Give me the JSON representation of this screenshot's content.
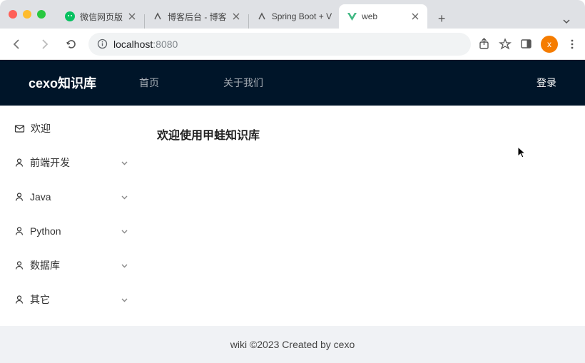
{
  "browser": {
    "tabs": [
      {
        "title": "微信网页版",
        "favicon": "wechat"
      },
      {
        "title": "博客后台 - 博客",
        "favicon": "generic"
      },
      {
        "title": "Spring Boot + V",
        "favicon": "generic"
      },
      {
        "title": "web",
        "favicon": "vue"
      }
    ],
    "active_tab_index": 3,
    "url_host": "localhost",
    "url_port": ":8080",
    "avatar_letter": "x"
  },
  "app": {
    "brand": "cexo知识库",
    "menu": [
      {
        "label": "首页"
      },
      {
        "label": "关于我们"
      }
    ],
    "login_label": "登录",
    "sidebar": [
      {
        "icon": "mail",
        "label": "欢迎",
        "expandable": false
      },
      {
        "icon": "user",
        "label": "前端开发",
        "expandable": true
      },
      {
        "icon": "user",
        "label": "Java",
        "expandable": true
      },
      {
        "icon": "user",
        "label": "Python",
        "expandable": true
      },
      {
        "icon": "user",
        "label": "数据库",
        "expandable": true
      },
      {
        "icon": "user",
        "label": "其它",
        "expandable": true
      }
    ],
    "content_heading": "欢迎使用甲蛙知识库",
    "footer": "wiki ©2023 Created by cexo"
  }
}
